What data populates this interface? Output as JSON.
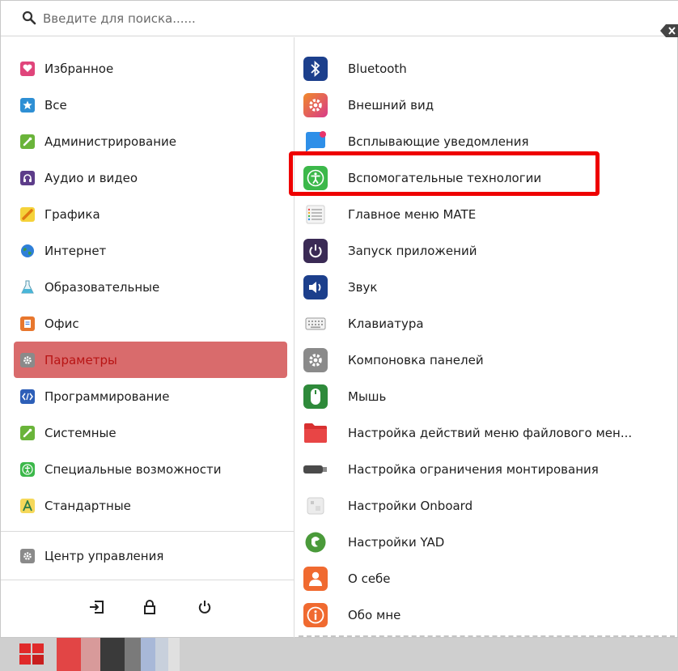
{
  "search": {
    "placeholder": "Введите для поиска......"
  },
  "categories": [
    {
      "label": "Избранное",
      "icon": "heart-icon",
      "color": "#e0457b"
    },
    {
      "label": "Все",
      "icon": "star-icon",
      "color": "#2e8fd4"
    },
    {
      "label": "Администрирование",
      "icon": "wrench-icon",
      "color": "#6ab43a"
    },
    {
      "label": "Аудио и видео",
      "icon": "headphones-icon",
      "color": "#5d3d8a"
    },
    {
      "label": "Графика",
      "icon": "pencil-icon",
      "color": "#f0a020"
    },
    {
      "label": "Интернет",
      "icon": "globe-icon",
      "color": "#2e7fd8"
    },
    {
      "label": "Образовательные",
      "icon": "flask-icon",
      "color": "#49b6d8"
    },
    {
      "label": "Офис",
      "icon": "document-icon",
      "color": "#e8772e"
    },
    {
      "label": "Параметры",
      "icon": "gear-icon",
      "color": "#8a8a8a",
      "active": true
    },
    {
      "label": "Программирование",
      "icon": "code-icon",
      "color": "#2d5fb8"
    },
    {
      "label": "Системные",
      "icon": "wrench-icon",
      "color": "#6ab43a"
    },
    {
      "label": "Специальные возможности",
      "icon": "accessibility-icon",
      "color": "#3cb84a"
    },
    {
      "label": "Стандартные",
      "icon": "text-icon",
      "color": "#f0b830"
    }
  ],
  "control_center": {
    "label": "Центр управления",
    "icon": "gear-icon"
  },
  "bottom_buttons": [
    {
      "icon": "logout-icon"
    },
    {
      "icon": "lock-icon"
    },
    {
      "icon": "power-icon"
    }
  ],
  "apps": [
    {
      "label": "Bluetooth",
      "icon": "bluetooth-icon",
      "color": "#1c3f8c"
    },
    {
      "label": "Внешний вид",
      "icon": "appearance-gear-icon",
      "color": "#d83a8a"
    },
    {
      "label": "Всплывающие уведомления",
      "icon": "notification-icon",
      "color": "#2e8fe8"
    },
    {
      "label": "Вспомогательные технологии",
      "icon": "accessibility-icon",
      "color": "#3cb84a",
      "highlighted": true
    },
    {
      "label": "Главное меню MATE",
      "icon": "menu-list-icon",
      "color": "#b8b8b8"
    },
    {
      "label": "Запуск приложений",
      "icon": "power-icon",
      "color": "#3a2a55"
    },
    {
      "label": "Звук",
      "icon": "speaker-icon",
      "color": "#1c3f8c"
    },
    {
      "label": "Клавиатура",
      "icon": "keyboard-icon",
      "color": "#8a8a8a"
    },
    {
      "label": "Компоновка панелей",
      "icon": "gear-icon",
      "color": "#8a8a8a"
    },
    {
      "label": "Мышь",
      "icon": "mouse-icon",
      "color": "#2e8a3a"
    },
    {
      "label": "Настройка действий меню файлового мен...",
      "icon": "folder-icon",
      "color": "#d83030"
    },
    {
      "label": "Настройка ограничения монтирования",
      "icon": "usb-drive-icon",
      "color": "#555555"
    },
    {
      "label": "Настройки Onboard",
      "icon": "onboard-keyboard-icon",
      "color": "#c8c8c8"
    },
    {
      "label": "Настройки YAD",
      "icon": "yad-icon",
      "color": "#4a9a3a"
    },
    {
      "label": "О себе",
      "icon": "user-icon",
      "color": "#f06a30"
    },
    {
      "label": "Обо мне",
      "icon": "info-icon",
      "color": "#f06a30"
    }
  ]
}
